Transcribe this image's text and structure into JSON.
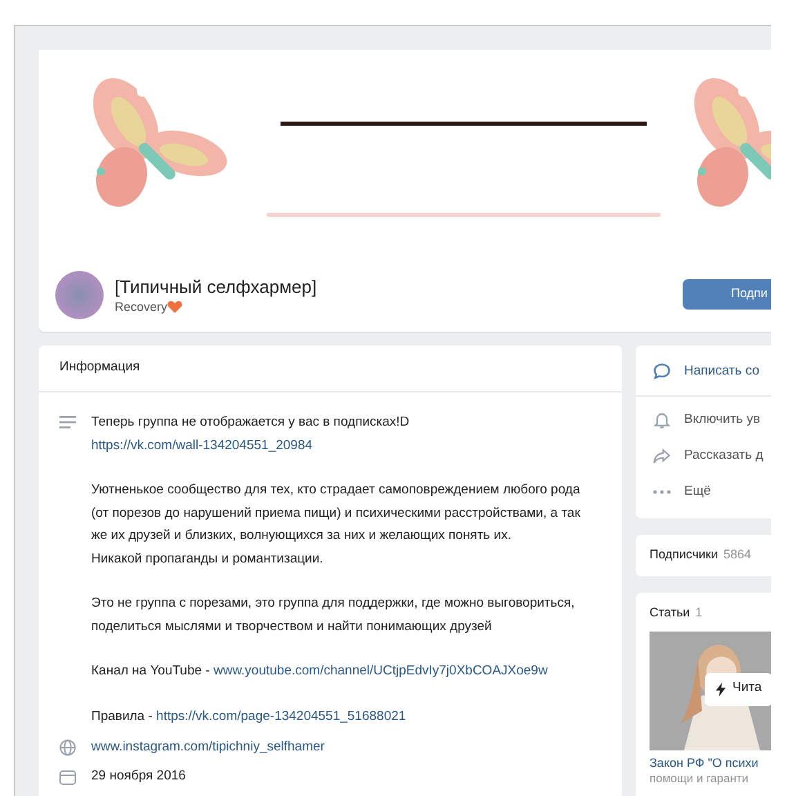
{
  "group": {
    "name": "[Типичный селфхармер]",
    "status": "Recovery",
    "subscribe_button": "Подпи"
  },
  "info": {
    "title": "Информация",
    "description": [
      [
        {
          "text": "Теперь группа не отображается у вас в подписках!D"
        },
        {
          "link": "https://vk.com/wall-134204551_20984"
        }
      ],
      [
        {
          "text": "Уютненькое сообщество для тех, кто страдает самоповреждением любого рода (от порезов до нарушений приема пищи) и психическими расстройствами, а так же их друзей и близких, волнующихся за них и желающих понять их."
        },
        {
          "text": "Никакой пропаганды и романтизации."
        }
      ],
      [
        {
          "text": "Это не группа с порезами, это группа для поддержки, где можно выговориться, поделиться мыслями и творчеством и найти понимающих друзей"
        }
      ],
      [
        {
          "text": "Канал на YouTube - ",
          "link": "www.youtube.com/channel/UCtjpEdvIy7j0XbCOAJXoe9w"
        }
      ],
      [
        {
          "text": "Правила - ",
          "link": "https://vk.com/page-134204551_51688021"
        }
      ]
    ],
    "website": "www.instagram.com/tipichniy_selfhamer",
    "date": "29 ноября 2016"
  },
  "actions": [
    {
      "kind": "message",
      "label": "Написать со"
    },
    {
      "kind": "bell",
      "label": "Включить ув"
    },
    {
      "kind": "share",
      "label": "Рассказать д"
    },
    {
      "kind": "more",
      "label": "Ещё"
    }
  ],
  "subscribers": {
    "label": "Подписчики",
    "count": "5864"
  },
  "articles": {
    "label": "Статьи",
    "count": "1",
    "read_button": "Чита",
    "title": "Закон РФ \"О психи",
    "subtitle": "помощи и гаранти"
  }
}
